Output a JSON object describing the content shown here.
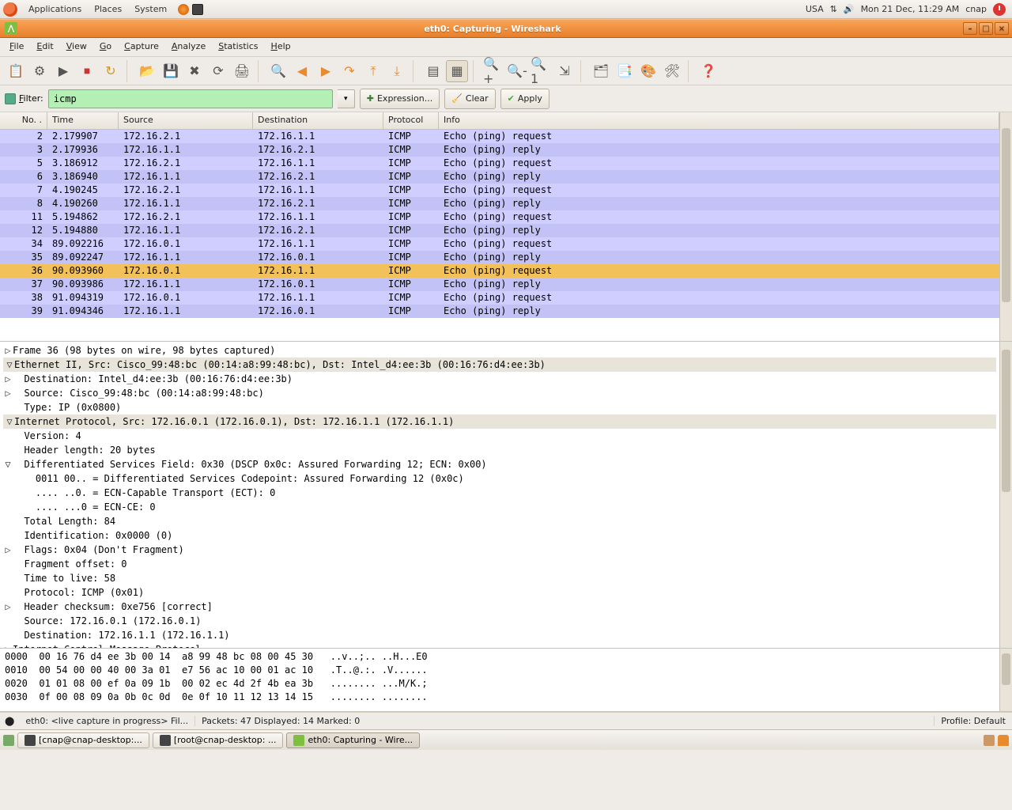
{
  "gnome_panel": {
    "menus": [
      "Applications",
      "Places",
      "System"
    ],
    "keyboard": "USA",
    "clock": "Mon 21 Dec, 11:29 AM",
    "user": "cnap"
  },
  "window": {
    "title": "eth0: Capturing - Wireshark"
  },
  "menubar": [
    "File",
    "Edit",
    "View",
    "Go",
    "Capture",
    "Analyze",
    "Statistics",
    "Help"
  ],
  "filter": {
    "label": "Filter:",
    "value": "icmp",
    "expression_btn": "Expression...",
    "clear_btn": "Clear",
    "apply_btn": "Apply"
  },
  "columns": [
    "No. .",
    "Time",
    "Source",
    "Destination",
    "Protocol",
    "Info"
  ],
  "packets": [
    {
      "no": 2,
      "time": "2.179907",
      "src": "172.16.2.1",
      "dst": "172.16.1.1",
      "proto": "ICMP",
      "info": "Echo (ping) request"
    },
    {
      "no": 3,
      "time": "2.179936",
      "src": "172.16.1.1",
      "dst": "172.16.2.1",
      "proto": "ICMP",
      "info": "Echo (ping) reply"
    },
    {
      "no": 5,
      "time": "3.186912",
      "src": "172.16.2.1",
      "dst": "172.16.1.1",
      "proto": "ICMP",
      "info": "Echo (ping) request"
    },
    {
      "no": 6,
      "time": "3.186940",
      "src": "172.16.1.1",
      "dst": "172.16.2.1",
      "proto": "ICMP",
      "info": "Echo (ping) reply"
    },
    {
      "no": 7,
      "time": "4.190245",
      "src": "172.16.2.1",
      "dst": "172.16.1.1",
      "proto": "ICMP",
      "info": "Echo (ping) request"
    },
    {
      "no": 8,
      "time": "4.190260",
      "src": "172.16.1.1",
      "dst": "172.16.2.1",
      "proto": "ICMP",
      "info": "Echo (ping) reply"
    },
    {
      "no": 11,
      "time": "5.194862",
      "src": "172.16.2.1",
      "dst": "172.16.1.1",
      "proto": "ICMP",
      "info": "Echo (ping) request"
    },
    {
      "no": 12,
      "time": "5.194880",
      "src": "172.16.1.1",
      "dst": "172.16.2.1",
      "proto": "ICMP",
      "info": "Echo (ping) reply"
    },
    {
      "no": 34,
      "time": "89.092216",
      "src": "172.16.0.1",
      "dst": "172.16.1.1",
      "proto": "ICMP",
      "info": "Echo (ping) request"
    },
    {
      "no": 35,
      "time": "89.092247",
      "src": "172.16.1.1",
      "dst": "172.16.0.1",
      "proto": "ICMP",
      "info": "Echo (ping) reply"
    },
    {
      "no": 36,
      "time": "90.093960",
      "src": "172.16.0.1",
      "dst": "172.16.1.1",
      "proto": "ICMP",
      "info": "Echo (ping) request",
      "selected": true
    },
    {
      "no": 37,
      "time": "90.093986",
      "src": "172.16.1.1",
      "dst": "172.16.0.1",
      "proto": "ICMP",
      "info": "Echo (ping) reply"
    },
    {
      "no": 38,
      "time": "91.094319",
      "src": "172.16.0.1",
      "dst": "172.16.1.1",
      "proto": "ICMP",
      "info": "Echo (ping) request"
    },
    {
      "no": 39,
      "time": "91.094346",
      "src": "172.16.1.1",
      "dst": "172.16.0.1",
      "proto": "ICMP",
      "info": "Echo (ping) reply"
    }
  ],
  "details": [
    {
      "exp": "▷",
      "ind": 0,
      "hdr": false,
      "txt": "Frame 36 (98 bytes on wire, 98 bytes captured)"
    },
    {
      "exp": "▽",
      "ind": 0,
      "hdr": true,
      "txt": "Ethernet II, Src: Cisco_99:48:bc (00:14:a8:99:48:bc), Dst: Intel_d4:ee:3b (00:16:76:d4:ee:3b)"
    },
    {
      "exp": "▷",
      "ind": 1,
      "hdr": false,
      "txt": "Destination: Intel_d4:ee:3b (00:16:76:d4:ee:3b)"
    },
    {
      "exp": "▷",
      "ind": 1,
      "hdr": false,
      "txt": "Source: Cisco_99:48:bc (00:14:a8:99:48:bc)"
    },
    {
      "exp": " ",
      "ind": 1,
      "hdr": false,
      "txt": "Type: IP (0x0800)"
    },
    {
      "exp": "▽",
      "ind": 0,
      "hdr": true,
      "txt": "Internet Protocol, Src: 172.16.0.1 (172.16.0.1), Dst: 172.16.1.1 (172.16.1.1)"
    },
    {
      "exp": " ",
      "ind": 1,
      "hdr": false,
      "txt": "Version: 4"
    },
    {
      "exp": " ",
      "ind": 1,
      "hdr": false,
      "txt": "Header length: 20 bytes"
    },
    {
      "exp": "▽",
      "ind": 1,
      "hdr": false,
      "txt": "Differentiated Services Field: 0x30 (DSCP 0x0c: Assured Forwarding 12; ECN: 0x00)"
    },
    {
      "exp": " ",
      "ind": 2,
      "hdr": false,
      "txt": "0011 00.. = Differentiated Services Codepoint: Assured Forwarding 12 (0x0c)"
    },
    {
      "exp": " ",
      "ind": 2,
      "hdr": false,
      "txt": ".... ..0. = ECN-Capable Transport (ECT): 0"
    },
    {
      "exp": " ",
      "ind": 2,
      "hdr": false,
      "txt": ".... ...0 = ECN-CE: 0"
    },
    {
      "exp": " ",
      "ind": 1,
      "hdr": false,
      "txt": "Total Length: 84"
    },
    {
      "exp": " ",
      "ind": 1,
      "hdr": false,
      "txt": "Identification: 0x0000 (0)"
    },
    {
      "exp": "▷",
      "ind": 1,
      "hdr": false,
      "txt": "Flags: 0x04 (Don't Fragment)"
    },
    {
      "exp": " ",
      "ind": 1,
      "hdr": false,
      "txt": "Fragment offset: 0"
    },
    {
      "exp": " ",
      "ind": 1,
      "hdr": false,
      "txt": "Time to live: 58"
    },
    {
      "exp": " ",
      "ind": 1,
      "hdr": false,
      "txt": "Protocol: ICMP (0x01)"
    },
    {
      "exp": "▷",
      "ind": 1,
      "hdr": false,
      "txt": "Header checksum: 0xe756 [correct]"
    },
    {
      "exp": " ",
      "ind": 1,
      "hdr": false,
      "txt": "Source: 172.16.0.1 (172.16.0.1)"
    },
    {
      "exp": " ",
      "ind": 1,
      "hdr": false,
      "txt": "Destination: 172.16.1.1 (172.16.1.1)"
    },
    {
      "exp": "▷",
      "ind": 0,
      "hdr": false,
      "txt": "Internet Control Message Protocol"
    }
  ],
  "hex": [
    "0000  00 16 76 d4 ee 3b 00 14  a8 99 48 bc 08 00 45 30   ..v..;.. ..H...E0",
    "0010  00 54 00 00 40 00 3a 01  e7 56 ac 10 00 01 ac 10   .T..@.:. .V......",
    "0020  01 01 08 00 ef 0a 09 1b  00 02 ec 4d 2f 4b ea 3b   ........ ...M/K.;",
    "0030  0f 00 08 09 0a 0b 0c 0d  0e 0f 10 11 12 13 14 15   ........ ........"
  ],
  "statusbar": {
    "left": "eth0: <live capture in progress> Fil...",
    "mid": "Packets: 47 Displayed: 14 Marked: 0",
    "right": "Profile: Default"
  },
  "taskbar": [
    {
      "label": "[cnap@cnap-desktop:...",
      "active": false
    },
    {
      "label": "[root@cnap-desktop: ...",
      "active": false
    },
    {
      "label": "eth0: Capturing - Wire...",
      "active": true
    }
  ]
}
